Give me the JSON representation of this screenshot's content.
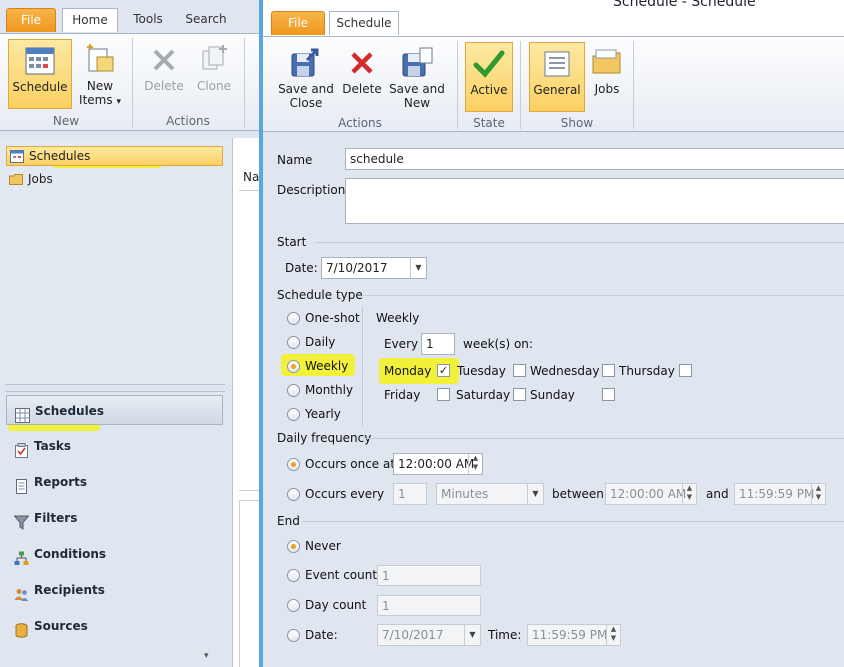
{
  "bg": {
    "tabs": {
      "file": "File",
      "home": "Home",
      "tools": "Tools",
      "search": "Search"
    },
    "ribbon": {
      "schedule": "Schedule",
      "new_items": "New Items",
      "new_items_arrow": "▾",
      "delete": "Delete",
      "clone": "Clone",
      "group_new": "New",
      "group_actions": "Actions"
    },
    "tree": {
      "schedules": "Schedules",
      "jobs": "Jobs"
    },
    "nav": [
      "Schedules",
      "Tasks",
      "Reports",
      "Filters",
      "Conditions",
      "Recipients",
      "Sources"
    ],
    "list_header": "Na",
    "nav_more_arrow": "▾"
  },
  "win": {
    "title": "Schedule - Schedule",
    "tabs": {
      "file": "File",
      "schedule": "Schedule"
    },
    "ribbon": {
      "save_close": "Save and Close",
      "delete": "Delete",
      "save_new": "Save and New",
      "active": "Active",
      "general": "General",
      "jobs": "Jobs",
      "group_actions": "Actions",
      "group_state": "State",
      "group_show": "Show"
    }
  },
  "form": {
    "name_label": "Name",
    "name_value": "schedule",
    "description_label": "Description",
    "description_value": "",
    "start_section": "Start",
    "date_label": "Date:",
    "date_value": "7/10/2017",
    "schedule_type_section": "Schedule type",
    "types": [
      "One-shot",
      "Daily",
      "Weekly",
      "Monthly",
      "Yearly"
    ],
    "selected_type": "Weekly",
    "weekly_title": "Weekly",
    "every_label": "Every",
    "every_value": "1",
    "weeks_on_label": "week(s) on:",
    "days": {
      "monday": "Monday",
      "tuesday": "Tuesday",
      "wednesday": "Wednesday",
      "thursday": "Thursday",
      "friday": "Friday",
      "saturday": "Saturday",
      "sunday": "Sunday"
    },
    "checked_mark": "✓",
    "daily_frequency_section": "Daily frequency",
    "occurs_once_label": "Occurs once at",
    "occurs_once_value": "12:00:00 AM",
    "occurs_every_label": "Occurs every",
    "occurs_every_value": "1",
    "unit_value": "Minutes",
    "between_label": "between",
    "between_start": "12:00:00 AM",
    "and_label": "and",
    "between_end": "11:59:59 PM",
    "end_section": "End",
    "never_label": "Never",
    "event_count_label": "Event count",
    "event_count_value": "1",
    "day_count_label": "Day count",
    "day_count_value": "1",
    "end_date_label": "Date:",
    "end_date_value": "7/10/2017",
    "time_label": "Time:",
    "time_value": "11:59:59 PM"
  },
  "colors": {
    "highlight": "#f4f21a",
    "selected_gradient_top": "#fde9a2",
    "selected_gradient_bottom": "#fbd062",
    "file_tab": "#f0971d",
    "window_border": "#5aa6e0"
  }
}
